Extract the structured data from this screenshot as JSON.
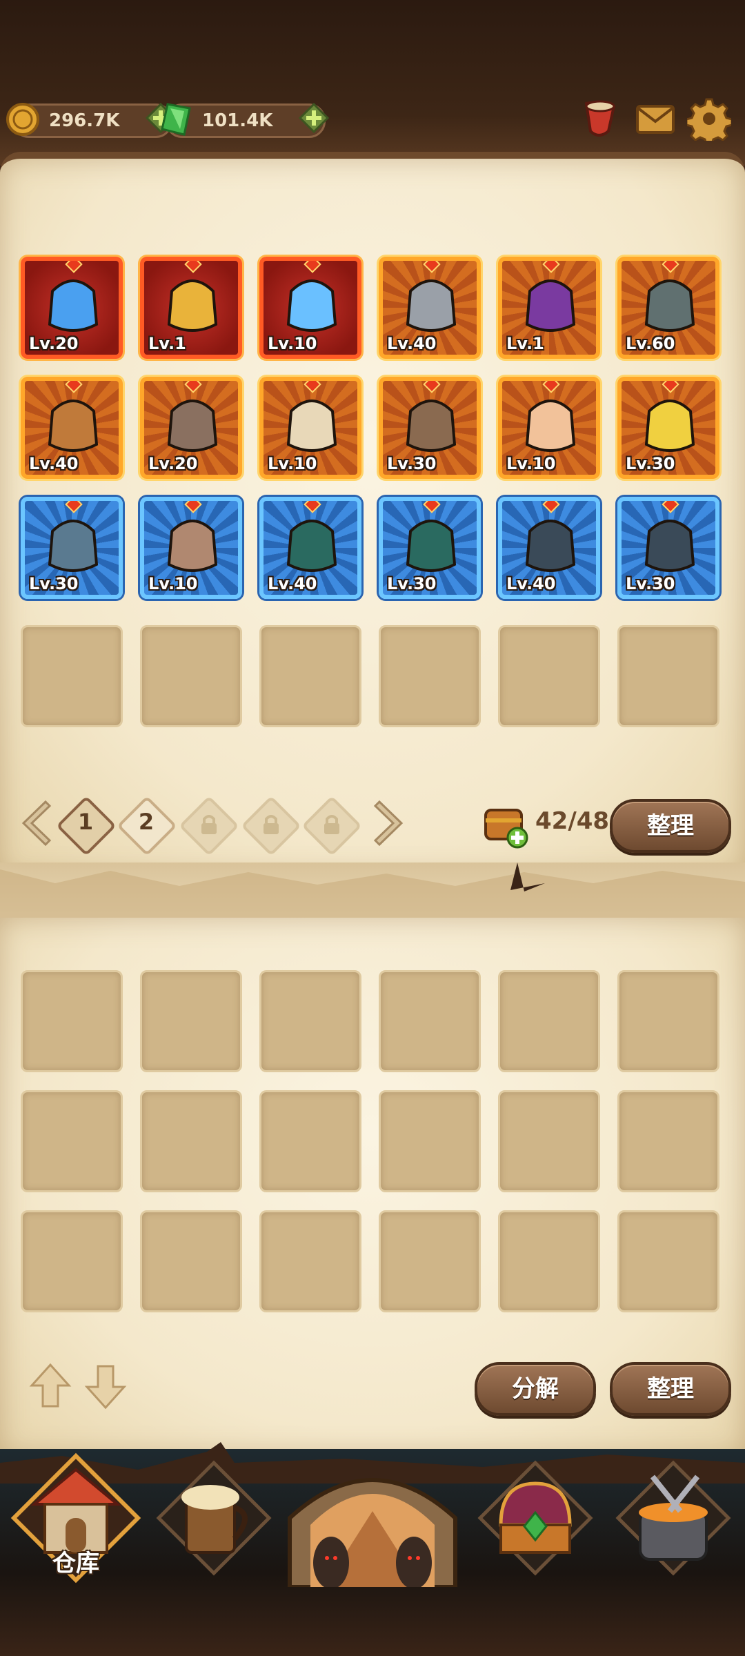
{
  "header": {
    "gold": "296.7K",
    "gems": "101.4K"
  },
  "pagination": {
    "pages": [
      {
        "label": "1",
        "state": "current"
      },
      {
        "label": "2",
        "state": "available"
      },
      {
        "label": "",
        "state": "locked"
      },
      {
        "label": "",
        "state": "locked"
      },
      {
        "label": "",
        "state": "locked"
      }
    ],
    "capacity": "42/48",
    "sort_label": "整理"
  },
  "equipped": [
    {
      "name": "arcane-swirl-armor",
      "rarity": "red",
      "level": "Lv.20"
    },
    {
      "name": "golden-gauntlet",
      "rarity": "red",
      "level": "Lv.1"
    },
    {
      "name": "orb-amulet",
      "rarity": "red",
      "level": "Lv.10"
    },
    {
      "name": "twisted-sword",
      "rarity": "orange",
      "level": "Lv.40"
    },
    {
      "name": "shadow-staff",
      "rarity": "orange",
      "level": "Lv.1"
    },
    {
      "name": "spiked-helmet",
      "rarity": "orange",
      "level": "Lv.60"
    },
    {
      "name": "bronze-helmet",
      "rarity": "orange",
      "level": "Lv.40"
    },
    {
      "name": "skull-pauldron",
      "rarity": "orange",
      "level": "Lv.20"
    },
    {
      "name": "fang-necklace",
      "rarity": "orange",
      "level": "Lv.10"
    },
    {
      "name": "leather-armor",
      "rarity": "orange",
      "level": "Lv.30"
    },
    {
      "name": "horn-ring",
      "rarity": "orange",
      "level": "Lv.10"
    },
    {
      "name": "golden-boots",
      "rarity": "orange",
      "level": "Lv.30"
    },
    {
      "name": "fur-helmet",
      "rarity": "blue",
      "level": "Lv.30"
    },
    {
      "name": "bandaged-armor",
      "rarity": "blue",
      "level": "Lv.10"
    },
    {
      "name": "green-glove",
      "rarity": "blue",
      "level": "Lv.40"
    },
    {
      "name": "green-glove",
      "rarity": "blue",
      "level": "Lv.30"
    },
    {
      "name": "iron-greaves",
      "rarity": "blue",
      "level": "Lv.40"
    },
    {
      "name": "iron-greaves",
      "rarity": "blue",
      "level": "Lv.30"
    }
  ],
  "lower_actions": {
    "decompose_label": "分解",
    "sort_label": "整理"
  },
  "bottom_nav": [
    {
      "name": "warehouse",
      "label": "仓库",
      "active": true
    },
    {
      "name": "tavern",
      "label": "",
      "active": false
    },
    {
      "name": "adventure",
      "label": "",
      "active": false
    },
    {
      "name": "treasure",
      "label": "",
      "active": false
    },
    {
      "name": "forge",
      "label": "",
      "active": false
    }
  ],
  "colors": {
    "rarity_red": "#c53028",
    "rarity_orange": "#d46d20",
    "rarity_blue": "#3e8be0",
    "parchment": "#f4e8cb",
    "button_brown": "#8a6243"
  }
}
